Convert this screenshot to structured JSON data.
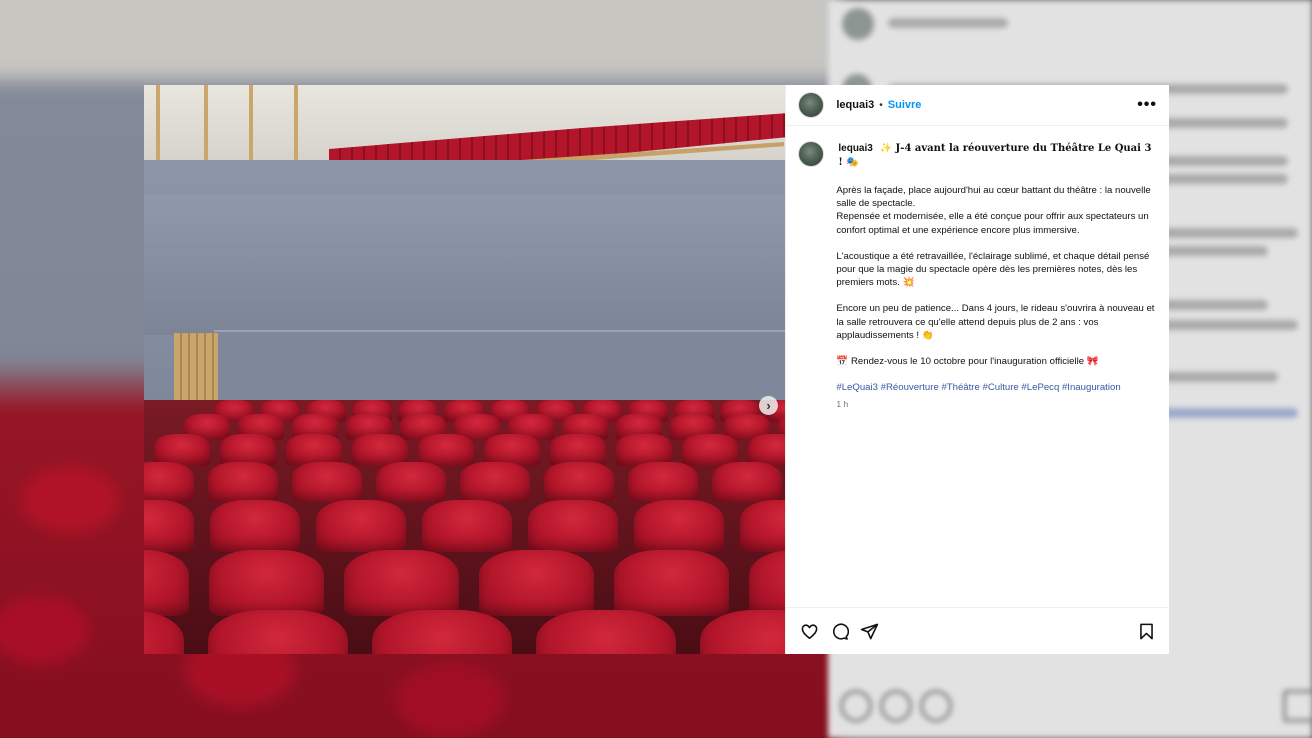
{
  "post": {
    "username": "lequai3",
    "follow_label": "Suivre",
    "dot": "•",
    "more": "•••",
    "caption_title": "✨ J-4 avant la réouverture du Théâtre Le Quai 3 ! 🎭",
    "caption_paragraphs": [
      "Après la façade, place aujourd'hui au cœur battant du théâtre : la nouvelle salle de spectacle.\nRepensée et modernisée, elle a été conçue pour offrir aux spectateurs un confort optimal et une expérience encore plus immersive.",
      "L'acoustique a été retravaillée, l'éclairage sublimé, et chaque détail pensé pour que la magie du spectacle opère dès les premières notes, dès les premiers mots. 💥",
      "Encore un peu de patience... Dans 4 jours, le rideau s'ouvrira à nouveau et la salle retrouvera ce qu'elle attend depuis plus de 2 ans : vos applaudissements ! 👏",
      "📅 Rendez-vous le 10 octobre pour l'inauguration officielle 🎀"
    ],
    "hashtags": "#LeQuai3 #Réouverture #Théâtre #Culture #LePecq #Inauguration",
    "timestamp": "1 h",
    "carousel_next": "›"
  },
  "actions": {
    "like_icon": "heart-icon",
    "comment_icon": "comment-icon",
    "share_icon": "share-icon",
    "save_icon": "bookmark-icon"
  },
  "colors": {
    "link_blue": "#0095f6",
    "hashtag_blue": "#3a57a6",
    "seat_red": "#b4162b",
    "wall_blue_gray": "#8a93a5"
  }
}
